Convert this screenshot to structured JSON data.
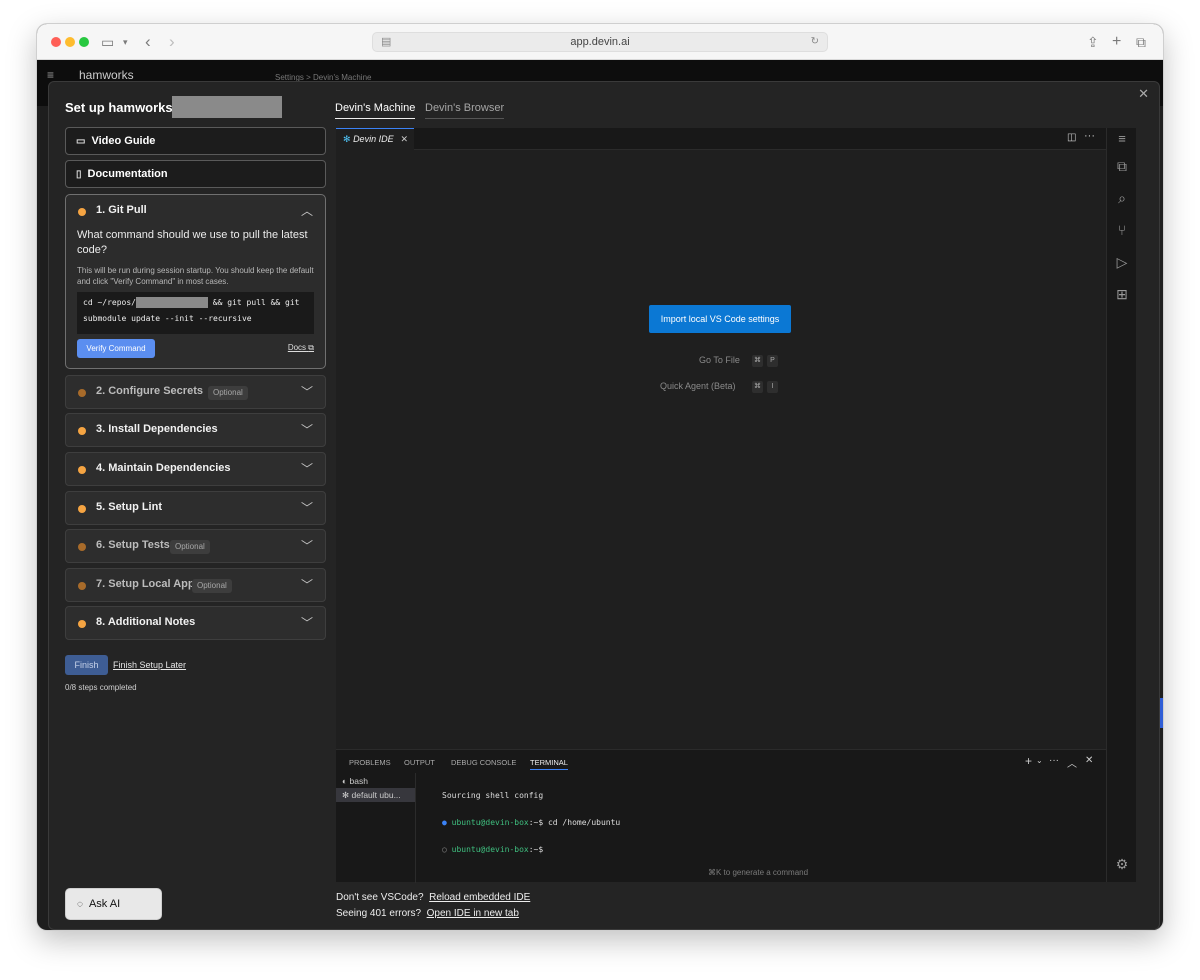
{
  "browser": {
    "url": "app.devin.ai"
  },
  "app": {
    "workspace": "hamworks",
    "breadcrumb": "Settings  >  Devin's Machine"
  },
  "setup": {
    "title": "Set up hamworks/",
    "video_guide": "Video Guide",
    "documentation": "Documentation",
    "git_pull": {
      "label": "1. Git Pull",
      "question": "What command should we use to pull the latest code?",
      "help": "This will be run during session startup. You should keep the default and click \"Verify Command\" in most cases.",
      "code_line1_a": "cd ~/repos/",
      "code_line1_b": " && git pull && git",
      "code_line2": "submodule update --init --recursive",
      "verify": "Verify Command",
      "docs": "Docs"
    },
    "steps": [
      {
        "label": "2. Configure Secrets",
        "optional": "Optional"
      },
      {
        "label": "3. Install Dependencies"
      },
      {
        "label": "4. Maintain Dependencies"
      },
      {
        "label": "5. Setup Lint"
      },
      {
        "label": "6. Setup Tests",
        "optional": "Optional"
      },
      {
        "label": "7. Setup Local App",
        "optional": "Optional"
      },
      {
        "label": "8. Additional Notes"
      }
    ],
    "finish": "Finish",
    "finish_later": "Finish Setup Later",
    "progress": "0/8 steps completed",
    "ask_ai": "Ask AI"
  },
  "tabs": [
    "Devin's Machine",
    "Devin's Browser"
  ],
  "ide": {
    "tab": "Devin IDE",
    "import_button": "Import local VS Code settings",
    "go_to_file": "Go To File",
    "go_to_file_keys": [
      "⌘",
      "P"
    ],
    "quick_agent": "Quick Agent (Beta)",
    "quick_agent_keys": [
      "⌘",
      "I"
    ],
    "panel_tabs": [
      "PROBLEMS",
      "OUTPUT",
      "DEBUG CONSOLE",
      "TERMINAL"
    ],
    "terminals": [
      "bash",
      "default  ubu..."
    ],
    "terminal_lines": {
      "line1": "Sourcing shell config",
      "prompt": "ubuntu@devin-box",
      "cmd1": ":~$ cd /home/ubuntu",
      "cmd2": ":~$"
    },
    "terminal_hint": "⌘K to generate a command"
  },
  "footer": {
    "q1": "Don't see VSCode?",
    "l1": "Reload embedded IDE",
    "q2": "Seeing 401 errors?",
    "l2": "Open IDE in new tab"
  }
}
